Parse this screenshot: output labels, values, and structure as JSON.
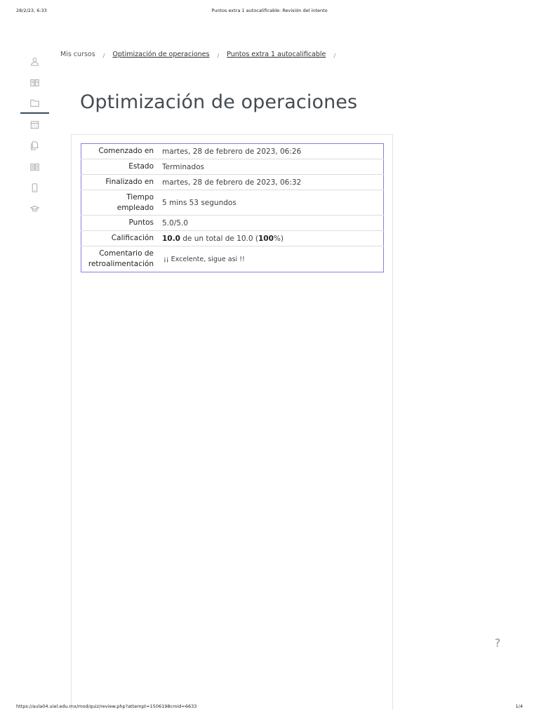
{
  "print_header": {
    "datetime": "28/2/23, 6:33",
    "page_title": "Puntos extra 1 autocalificable: Revisión del intento"
  },
  "print_footer": {
    "url": "https://aula04.uiel.edu.mx/mod/quiz/review.php?attempt=1506198cmid=6633",
    "page_count": "1/4"
  },
  "sidebar": {
    "items": [
      {
        "icon": "user-icon"
      },
      {
        "icon": "book-icon"
      },
      {
        "icon": "folder-icon",
        "active": true
      },
      {
        "icon": "calendar-icon"
      },
      {
        "icon": "copy-icon"
      },
      {
        "icon": "book-open-icon"
      },
      {
        "icon": "mobile-icon"
      },
      {
        "icon": "graduation-cap-icon"
      }
    ]
  },
  "breadcrumb": {
    "items": [
      "Mis cursos",
      "Optimización de operaciones",
      "Puntos extra 1 autocalificable"
    ],
    "separator": "/"
  },
  "page": {
    "title": "Optimización de operaciones"
  },
  "summary": {
    "started_label": "Comenzado en",
    "started_value": "martes, 28 de febrero de 2023, 06:26",
    "state_label": "Estado",
    "state_value": "Terminados",
    "finished_label": "Finalizado en",
    "finished_value": "martes, 28 de febrero de 2023, 06:32",
    "time_label_1": "Tiempo",
    "time_label_2": "empleado",
    "time_value": "5 mins 53 segundos",
    "points_label": "Puntos",
    "points_value": "5.0/5.0",
    "grade_label": "Calificación",
    "grade_score": "10.0",
    "grade_middle": " de un total de 10.0 (",
    "grade_percent": "100",
    "grade_end": "%)",
    "feedback_label_1": "Comentario de",
    "feedback_label_2": "retroalimentación",
    "feedback_value": "¡¡ Excelente, sigue asi !!"
  },
  "help": {
    "label": "?"
  },
  "colors": {
    "table_border": "#8b7ee0",
    "active_indicator": "#3d4c5c"
  }
}
